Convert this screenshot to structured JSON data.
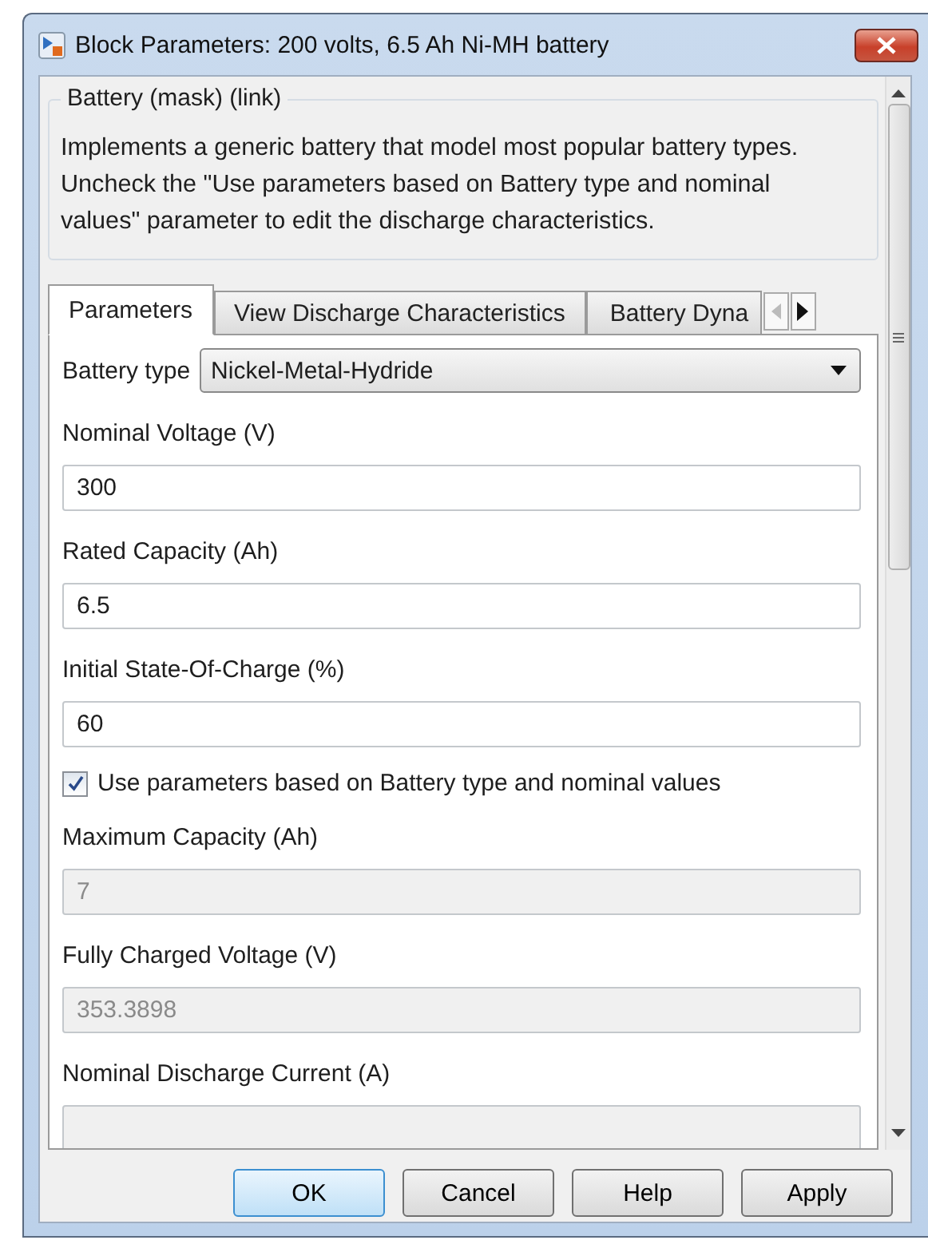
{
  "window": {
    "title": "Block Parameters: 200 volts, 6.5 Ah Ni-MH battery"
  },
  "group": {
    "title": "Battery (mask) (link)",
    "description": "Implements a generic battery that model most popular battery types. Uncheck the \"Use parameters based on Battery type and nominal values\" parameter to edit the discharge characteristics."
  },
  "tabs": [
    {
      "label": "Parameters",
      "selected": true
    },
    {
      "label": "View Discharge Characteristics",
      "selected": false
    },
    {
      "label": "Battery Dyna",
      "selected": false
    }
  ],
  "battery_type": {
    "label": "Battery type",
    "value": "Nickel-Metal-Hydride"
  },
  "parameters": [
    {
      "kind": "field",
      "label": "Nominal Voltage (V)",
      "value": "300",
      "disabled": false
    },
    {
      "kind": "field",
      "label": "Rated Capacity (Ah)",
      "value": "6.5",
      "disabled": false
    },
    {
      "kind": "field",
      "label": "Initial State-Of-Charge (%)",
      "value": "60",
      "disabled": false
    },
    {
      "kind": "checkbox",
      "label": "Use parameters based on Battery type and nominal values",
      "checked": true
    },
    {
      "kind": "field",
      "label": "Maximum Capacity (Ah)",
      "value": "7",
      "disabled": true
    },
    {
      "kind": "field",
      "label": "Fully Charged Voltage (V)",
      "value": "353.3898",
      "disabled": true
    },
    {
      "kind": "field",
      "label": "Nominal Discharge Current (A)",
      "disabled": true
    }
  ],
  "buttons": [
    {
      "label": "OK",
      "default": true
    },
    {
      "label": "Cancel",
      "default": false
    },
    {
      "label": "Help",
      "default": false
    },
    {
      "label": "Apply",
      "default": false
    }
  ]
}
